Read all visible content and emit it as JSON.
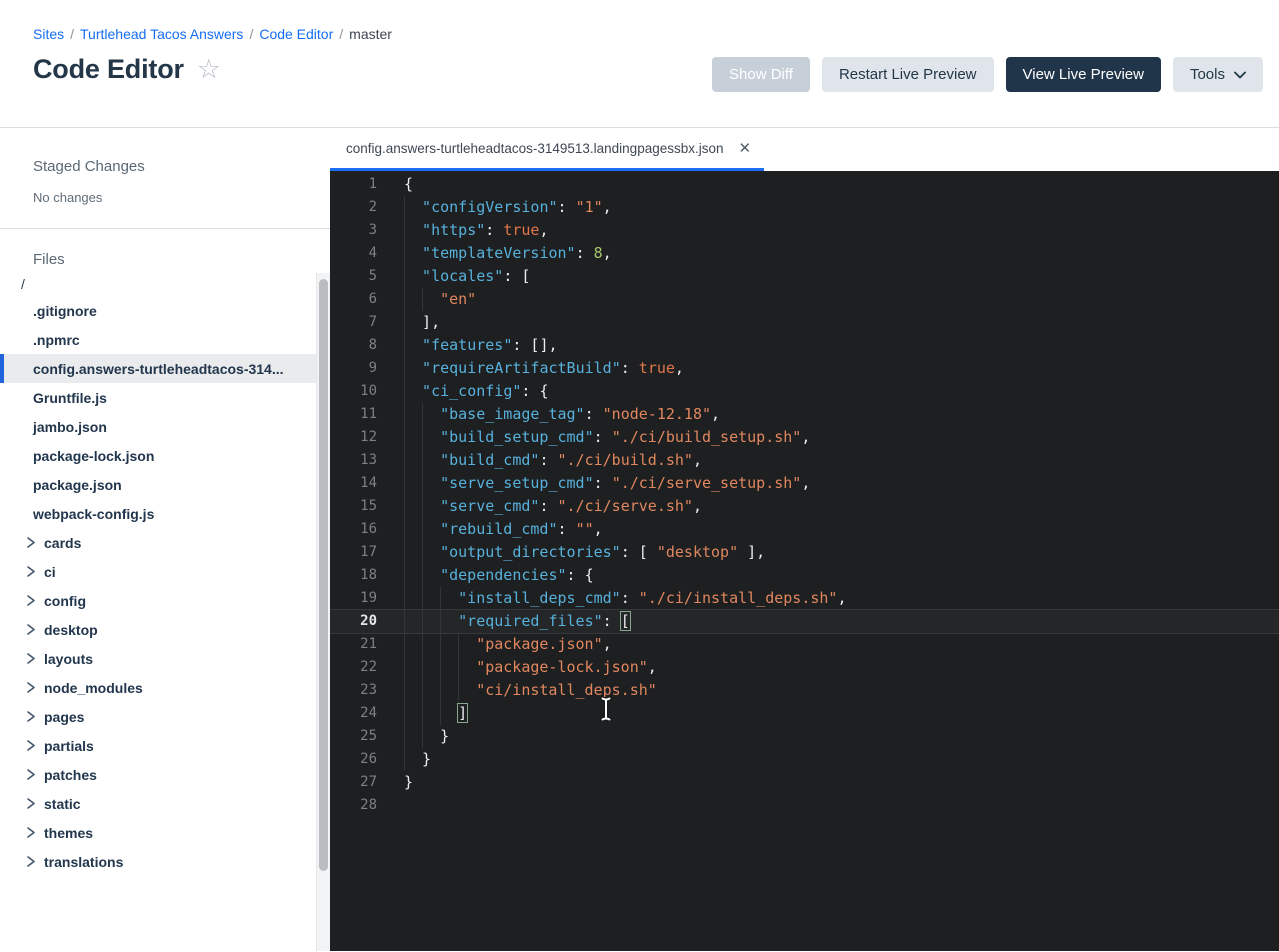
{
  "header": {
    "breadcrumb": [
      {
        "label": "Sites",
        "link": true
      },
      {
        "label": "Turtlehead Tacos Answers",
        "link": true
      },
      {
        "label": "Code Editor",
        "link": true
      },
      {
        "label": "master",
        "link": false
      }
    ],
    "breadcrumb_separator": "/",
    "title": "Code Editor",
    "star_glyph": "☆"
  },
  "toolbar": {
    "show_diff_label": "Show Diff",
    "restart_label": "Restart Live Preview",
    "view_label": "View Live Preview",
    "tools_label": "Tools"
  },
  "sidebar": {
    "staged_title": "Staged Changes",
    "staged_empty": "No changes",
    "files_title": "Files",
    "root_label": "/",
    "files": [
      {
        "name": ".gitignore",
        "selected": false
      },
      {
        "name": ".npmrc",
        "selected": false
      },
      {
        "name": "config.answers-turtleheadtacos-314...",
        "selected": true
      },
      {
        "name": "Gruntfile.js",
        "selected": false
      },
      {
        "name": "jambo.json",
        "selected": false
      },
      {
        "name": "package-lock.json",
        "selected": false
      },
      {
        "name": "package.json",
        "selected": false
      },
      {
        "name": "webpack-config.js",
        "selected": false
      }
    ],
    "folders": [
      {
        "name": "cards"
      },
      {
        "name": "ci"
      },
      {
        "name": "config"
      },
      {
        "name": "desktop"
      },
      {
        "name": "layouts"
      },
      {
        "name": "node_modules"
      },
      {
        "name": "pages"
      },
      {
        "name": "partials"
      },
      {
        "name": "patches"
      },
      {
        "name": "static"
      },
      {
        "name": "themes"
      },
      {
        "name": "translations"
      }
    ]
  },
  "editor": {
    "tab_title": "config.answers-turtleheadtacos-3149513.landingpagessbx.json",
    "tab_close_glyph": "✕",
    "lines": [
      {
        "n": 1,
        "indent": 0,
        "tokens": [
          [
            "p",
            "{"
          ]
        ]
      },
      {
        "n": 2,
        "indent": 1,
        "tokens": [
          [
            "k",
            "\"configVersion\""
          ],
          [
            "p",
            ": "
          ],
          [
            "s",
            "\"1\""
          ],
          [
            "p",
            ","
          ]
        ]
      },
      {
        "n": 3,
        "indent": 1,
        "tokens": [
          [
            "k",
            "\"https\""
          ],
          [
            "p",
            ": "
          ],
          [
            "b",
            "true"
          ],
          [
            "p",
            ","
          ]
        ]
      },
      {
        "n": 4,
        "indent": 1,
        "tokens": [
          [
            "k",
            "\"templateVersion\""
          ],
          [
            "p",
            ": "
          ],
          [
            "n",
            "8"
          ],
          [
            "p",
            ","
          ]
        ]
      },
      {
        "n": 5,
        "indent": 1,
        "tokens": [
          [
            "k",
            "\"locales\""
          ],
          [
            "p",
            ": ["
          ]
        ]
      },
      {
        "n": 6,
        "indent": 2,
        "tokens": [
          [
            "s",
            "\"en\""
          ]
        ]
      },
      {
        "n": 7,
        "indent": 1,
        "tokens": [
          [
            "p",
            "],"
          ]
        ]
      },
      {
        "n": 8,
        "indent": 1,
        "tokens": [
          [
            "k",
            "\"features\""
          ],
          [
            "p",
            ": [],"
          ]
        ]
      },
      {
        "n": 9,
        "indent": 1,
        "tokens": [
          [
            "k",
            "\"requireArtifactBuild\""
          ],
          [
            "p",
            ": "
          ],
          [
            "b",
            "true"
          ],
          [
            "p",
            ","
          ]
        ]
      },
      {
        "n": 10,
        "indent": 1,
        "tokens": [
          [
            "k",
            "\"ci_config\""
          ],
          [
            "p",
            ": {"
          ]
        ]
      },
      {
        "n": 11,
        "indent": 2,
        "tokens": [
          [
            "k",
            "\"base_image_tag\""
          ],
          [
            "p",
            ": "
          ],
          [
            "s",
            "\"node-12.18\""
          ],
          [
            "p",
            ","
          ]
        ]
      },
      {
        "n": 12,
        "indent": 2,
        "tokens": [
          [
            "k",
            "\"build_setup_cmd\""
          ],
          [
            "p",
            ": "
          ],
          [
            "s",
            "\"./ci/build_setup.sh\""
          ],
          [
            "p",
            ","
          ]
        ]
      },
      {
        "n": 13,
        "indent": 2,
        "tokens": [
          [
            "k",
            "\"build_cmd\""
          ],
          [
            "p",
            ": "
          ],
          [
            "s",
            "\"./ci/build.sh\""
          ],
          [
            "p",
            ","
          ]
        ]
      },
      {
        "n": 14,
        "indent": 2,
        "tokens": [
          [
            "k",
            "\"serve_setup_cmd\""
          ],
          [
            "p",
            ": "
          ],
          [
            "s",
            "\"./ci/serve_setup.sh\""
          ],
          [
            "p",
            ","
          ]
        ]
      },
      {
        "n": 15,
        "indent": 2,
        "tokens": [
          [
            "k",
            "\"serve_cmd\""
          ],
          [
            "p",
            ": "
          ],
          [
            "s",
            "\"./ci/serve.sh\""
          ],
          [
            "p",
            ","
          ]
        ]
      },
      {
        "n": 16,
        "indent": 2,
        "tokens": [
          [
            "k",
            "\"rebuild_cmd\""
          ],
          [
            "p",
            ": "
          ],
          [
            "s",
            "\"\""
          ],
          [
            "p",
            ","
          ]
        ]
      },
      {
        "n": 17,
        "indent": 2,
        "tokens": [
          [
            "k",
            "\"output_directories\""
          ],
          [
            "p",
            ": [ "
          ],
          [
            "s",
            "\"desktop\""
          ],
          [
            "p",
            " ],"
          ]
        ]
      },
      {
        "n": 18,
        "indent": 2,
        "tokens": [
          [
            "k",
            "\"dependencies\""
          ],
          [
            "p",
            ": {"
          ]
        ]
      },
      {
        "n": 19,
        "indent": 3,
        "tokens": [
          [
            "k",
            "\"install_deps_cmd\""
          ],
          [
            "p",
            ": "
          ],
          [
            "s",
            "\"./ci/install_deps.sh\""
          ],
          [
            "p",
            ","
          ]
        ]
      },
      {
        "n": 20,
        "indent": 3,
        "active": true,
        "tokens": [
          [
            "k",
            "\"required_files\""
          ],
          [
            "p",
            ": "
          ],
          [
            "bm",
            "["
          ]
        ]
      },
      {
        "n": 21,
        "indent": 4,
        "tokens": [
          [
            "s",
            "\"package.json\""
          ],
          [
            "p",
            ","
          ]
        ]
      },
      {
        "n": 22,
        "indent": 4,
        "tokens": [
          [
            "s",
            "\"package-lock.json\""
          ],
          [
            "p",
            ","
          ]
        ]
      },
      {
        "n": 23,
        "indent": 4,
        "tokens": [
          [
            "s",
            "\"ci/install_deps.sh\""
          ]
        ]
      },
      {
        "n": 24,
        "indent": 3,
        "tokens": [
          [
            "bm",
            "]"
          ]
        ]
      },
      {
        "n": 25,
        "indent": 2,
        "tokens": [
          [
            "p",
            "}"
          ]
        ]
      },
      {
        "n": 26,
        "indent": 1,
        "tokens": [
          [
            "p",
            "}"
          ]
        ]
      },
      {
        "n": 27,
        "indent": 0,
        "tokens": [
          [
            "p",
            "}"
          ]
        ]
      },
      {
        "n": 28,
        "indent": 0,
        "tokens": []
      }
    ]
  },
  "colors": {
    "accent_blue": "#1b6ef3",
    "link_blue": "#156ef5",
    "navy": "#20344a",
    "editor_bg": "#1d1f20",
    "token_key": "#58b1dc",
    "token_string": "#e0875f",
    "token_boolean": "#e0764b",
    "token_number": "#a9c76d",
    "token_punct": "#ecedee",
    "selected_row_bg": "#e9ebed"
  }
}
